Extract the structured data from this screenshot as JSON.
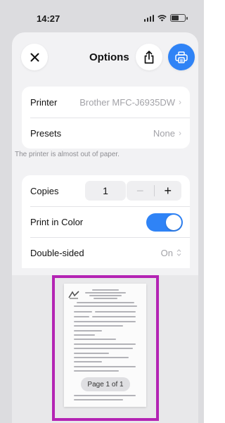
{
  "status_bar": {
    "time": "14:27"
  },
  "nav": {
    "title": "Options",
    "icons": {
      "close": "close-icon",
      "share": "share-icon",
      "print": "print-icon"
    }
  },
  "printer_group": {
    "printer_label": "Printer",
    "printer_value": "Brother MFC-J6935DW",
    "presets_label": "Presets",
    "presets_value": "None"
  },
  "note": "The printer is almost out of paper.",
  "options_group": {
    "copies_label": "Copies",
    "copies_value": "1",
    "minus": "−",
    "plus": "+",
    "color_label": "Print in Color",
    "color_on": true,
    "double_sided_label": "Double-sided",
    "double_sided_value": "On"
  },
  "preview": {
    "page_badge": "Page 1 of 1"
  },
  "colors": {
    "accent": "#2f83f6",
    "highlight": "#b424b4"
  }
}
